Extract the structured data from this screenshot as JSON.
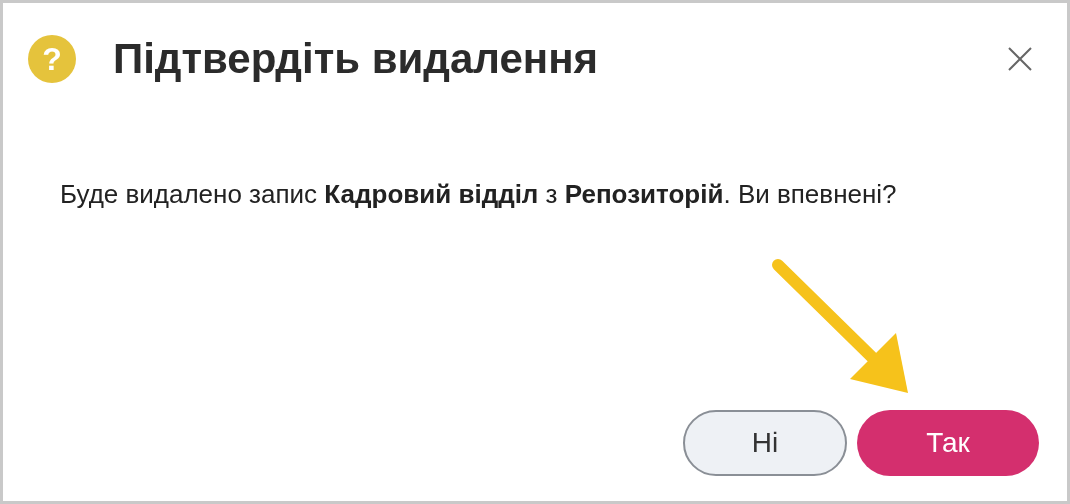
{
  "dialog": {
    "icon_glyph": "?",
    "title": "Підтвердіть видалення",
    "message": "Буде видалено запис **Кадровий відділ** з **Репозиторій**. Ви впевнені?",
    "buttons": [
      {
        "label": "Ні",
        "kind": "secondary"
      },
      {
        "label": "Так",
        "kind": "primary"
      }
    ]
  }
}
